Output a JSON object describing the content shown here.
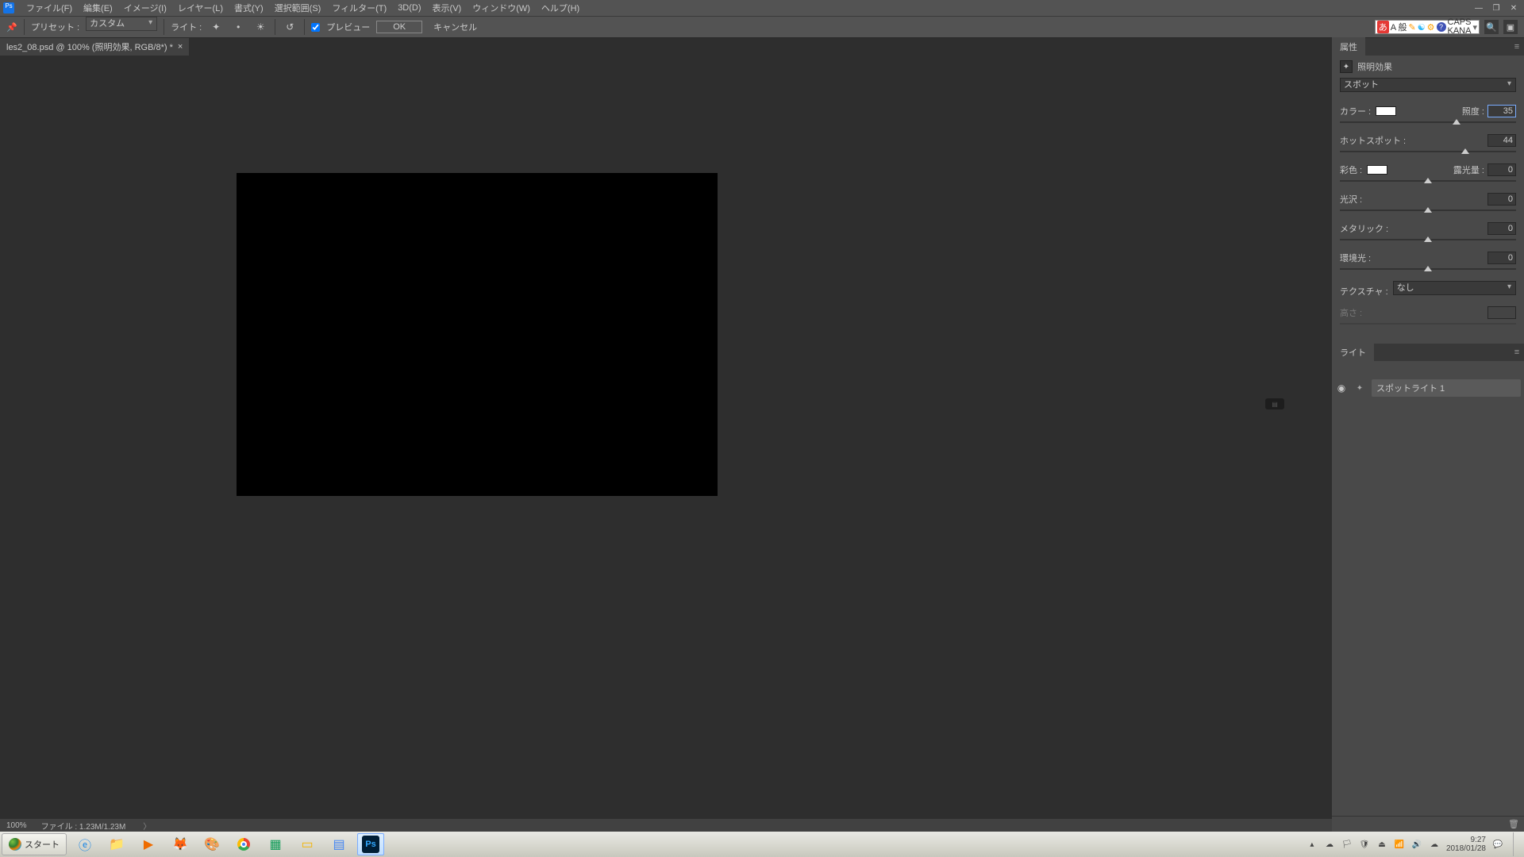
{
  "menu": {
    "items": [
      "ファイル(F)",
      "編集(E)",
      "イメージ(I)",
      "レイヤー(L)",
      "書式(Y)",
      "選択範囲(S)",
      "フィルター(T)",
      "3D(D)",
      "表示(V)",
      "ウィンドウ(W)",
      "ヘルプ(H)"
    ]
  },
  "window_controls": {
    "min": "—",
    "max": "❐",
    "close": "✕"
  },
  "options": {
    "preset_label": "プリセット :",
    "preset_value": "カスタム",
    "light_label": "ライト :",
    "preview_label": "プレビュー",
    "ok": "OK",
    "cancel": "キャンセル",
    "ime": {
      "a": "あ",
      "han": "A 般",
      "caps": "CAPS",
      "kana": "KANA"
    }
  },
  "doc_tab": {
    "title": "les2_08.psd @ 100% (照明効果, RGB/8*) *"
  },
  "properties": {
    "panel_title": "属性",
    "effect_title": "照明効果",
    "light_type": "スポット",
    "color_label": "カラー :",
    "color_swatch": "#ffffff",
    "intensity_label": "照度 :",
    "intensity_value": "35",
    "hotspot_label": "ホットスポット :",
    "hotspot_value": "44",
    "colorize_label": "彩色 :",
    "colorize_swatch": "#ffffff",
    "exposure_label": "露光量 :",
    "exposure_value": "0",
    "gloss_label": "光沢 :",
    "gloss_value": "0",
    "metallic_label": "メタリック :",
    "metallic_value": "0",
    "ambience_label": "環境光 :",
    "ambience_value": "0",
    "texture_label": "テクスチャ :",
    "texture_value": "なし",
    "height_label": "高さ :",
    "height_value": ""
  },
  "lights_panel": {
    "title": "ライト",
    "items": [
      {
        "visible": true,
        "name": "スポットライト 1"
      }
    ]
  },
  "statusbar": {
    "zoom": "100%",
    "file_info": "ファイル : 1.23M/1.23M"
  },
  "taskbar": {
    "start": "スタート",
    "clock_time": "9:27",
    "clock_date": "2018/01/28"
  }
}
